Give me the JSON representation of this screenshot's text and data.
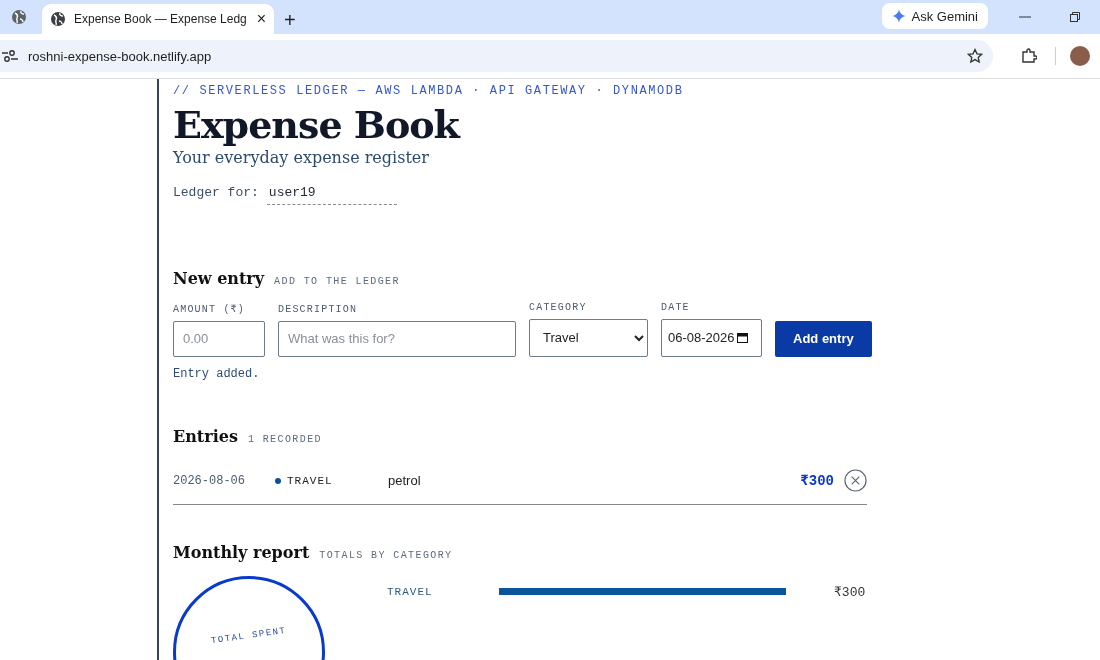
{
  "browser": {
    "tab_title": "Expense Book — Expense Ledg",
    "new_tab": "+",
    "close": "×",
    "gemini": "Ask Gemini",
    "url": "roshni-expense-book.netlify.app"
  },
  "header": {
    "eyebrow": "// SERVERLESS LEDGER — AWS LAMBDA · API GATEWAY · DYNAMODB",
    "title": "Expense Book",
    "subtitle": "Your everyday expense register",
    "ledger_label": "Ledger for:",
    "ledger_user": "user19"
  },
  "new_entry": {
    "title": "New entry",
    "subtitle": "ADD TO THE LEDGER",
    "fields": [
      {
        "kind": "input",
        "label": "AMOUNT (₹)",
        "placeholder": "0.00"
      },
      {
        "kind": "input",
        "label": "DESCRIPTION",
        "placeholder": "What was this for?"
      },
      {
        "kind": "select",
        "label": "CATEGORY",
        "value": "Travel"
      },
      {
        "kind": "date",
        "label": "DATE",
        "value": "06-08-2026"
      }
    ],
    "button": "Add entry",
    "status": "Entry added."
  },
  "entries": {
    "title": "Entries",
    "count": "1 RECORDED",
    "rows": [
      {
        "date": "2026-08-06",
        "category": "TRAVEL",
        "description": "petrol",
        "amount": "₹300"
      }
    ]
  },
  "report": {
    "title": "Monthly report",
    "subtitle": "TOTALS BY CATEGORY",
    "total_label": "TOTAL SPENT",
    "categories": [
      {
        "name": "TRAVEL",
        "level": 1,
        "amount": "₹300"
      }
    ]
  }
}
